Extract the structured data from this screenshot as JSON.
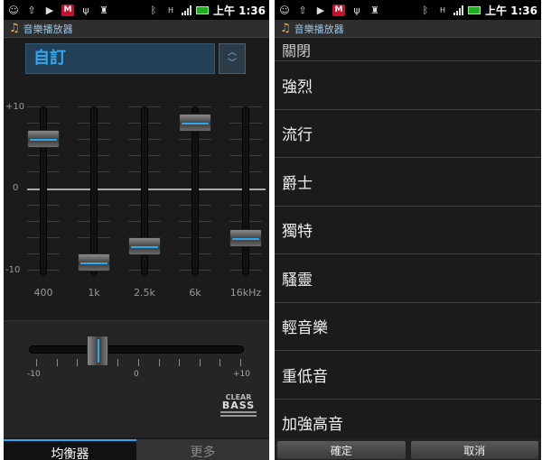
{
  "status": {
    "time": "上午 1:36"
  },
  "app": {
    "title": "音樂播放器"
  },
  "equalizer": {
    "preset": "自訂",
    "db_labels": {
      "top": "+10",
      "zero": "0",
      "bottom": "-10"
    },
    "bands": [
      {
        "freq": "400",
        "level_db": 6
      },
      {
        "freq": "1k",
        "level_db": -9
      },
      {
        "freq": "2.5k",
        "level_db": -7
      },
      {
        "freq": "6k",
        "level_db": 8
      },
      {
        "freq": "16kHz",
        "level_db": -6
      }
    ]
  },
  "bass": {
    "min_label": "-10",
    "zero_label": "0",
    "max_label": "+10",
    "level": -4,
    "logo_top": "CLEAR",
    "logo_bottom": "BASS"
  },
  "tabs": {
    "equalizer": "均衡器",
    "more": "更多"
  },
  "preset_list": {
    "partial_item": "關閉",
    "items": [
      "強烈",
      "流行",
      "爵士",
      "獨特",
      "騷靈",
      "輕音樂",
      "重低音",
      "加強高音"
    ]
  },
  "dialog": {
    "ok": "確定",
    "cancel": "取消"
  }
}
